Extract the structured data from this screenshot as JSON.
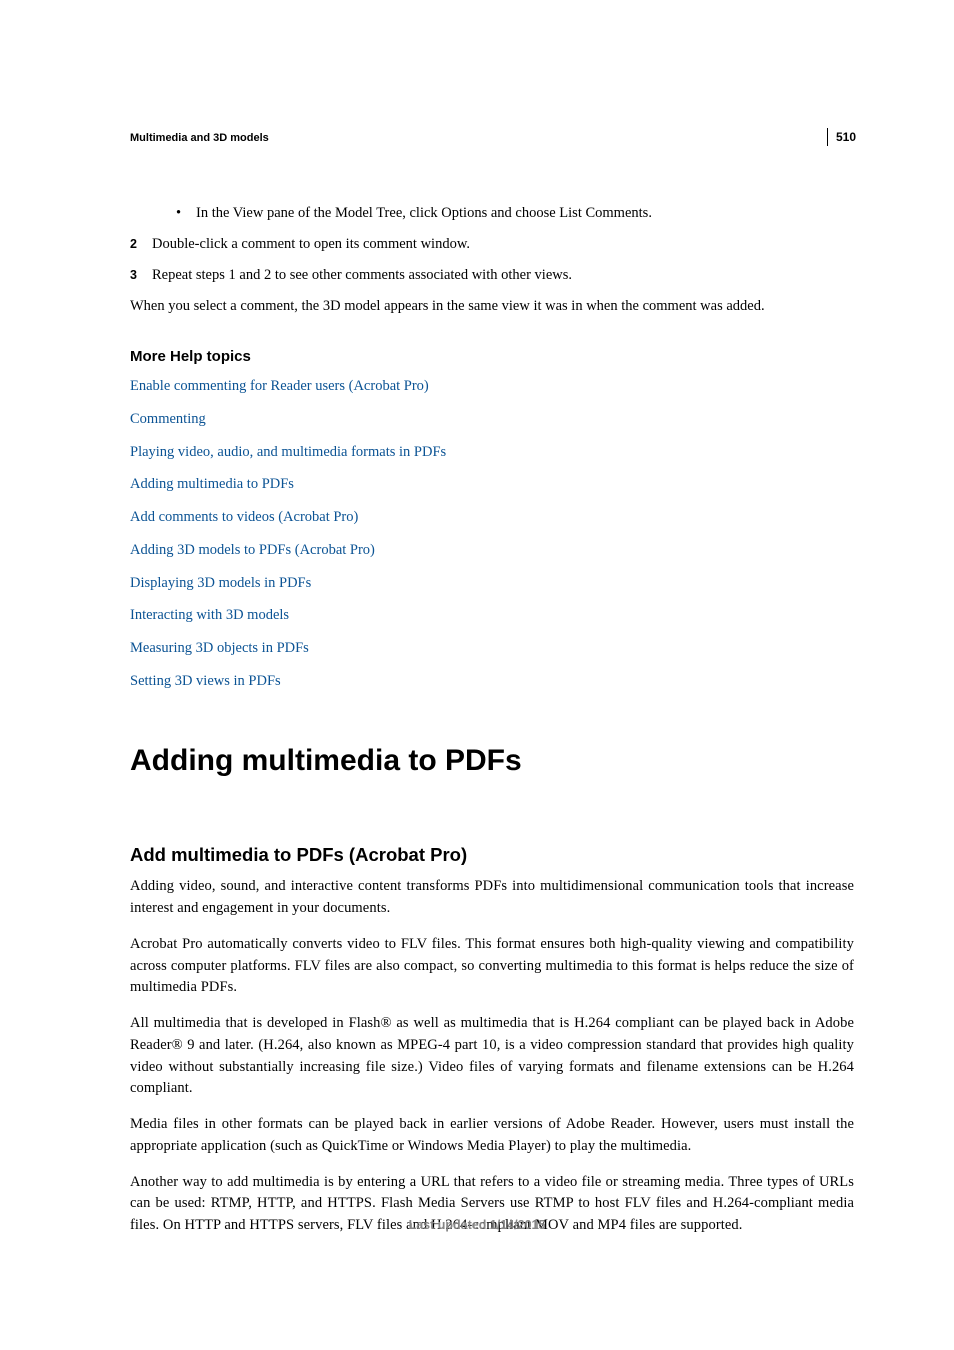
{
  "pageNumber": "510",
  "sectionHeader": "Multimedia and 3D models",
  "bulletItem": "In the View pane of the Model Tree, click Options and choose List Comments.",
  "steps": {
    "n2": "2",
    "t2": "Double-click a comment to open its comment window.",
    "n3": "3",
    "t3": "Repeat steps 1 and 2 to see other comments associated with other views."
  },
  "note": "When you select a comment, the 3D model appears in the same view it was in when the comment was added.",
  "moreHelp": {
    "heading": "More Help topics",
    "links": [
      "Enable commenting for Reader users (Acrobat Pro)",
      "Commenting",
      "Playing video, audio, and multimedia formats in PDFs",
      "Adding multimedia to PDFs",
      "Add comments to videos (Acrobat Pro)",
      "Adding 3D models to PDFs (Acrobat Pro)",
      "Displaying 3D models in PDFs",
      "Interacting with 3D models",
      "Measuring 3D objects in PDFs",
      "Setting 3D views in PDFs"
    ]
  },
  "mainHeading": "Adding multimedia to PDFs",
  "subHeading": "Add multimedia to PDFs (Acrobat Pro)",
  "paragraphs": {
    "p1": "Adding video, sound, and interactive content transforms PDFs into multidimensional communication tools that increase interest and engagement in your documents.",
    "p2": "Acrobat Pro automatically converts video to FLV files. This format ensures both high-quality viewing and compatibility across computer platforms. FLV files are also compact, so converting multimedia to this format is helps reduce the size of multimedia PDFs.",
    "p3": "All multimedia that is developed in Flash® as well as multimedia that is H.264 compliant can be played back in Adobe Reader® 9 and later. (H.264, also known as MPEG-4 part 10, is a video compression standard that provides high quality video without substantially increasing file size.) Video files of varying formats and filename extensions can be H.264 compliant.",
    "p4": "Media files in other formats can be played back in earlier versions of Adobe Reader. However, users must install the appropriate application (such as QuickTime or Windows Media Player) to play the multimedia.",
    "p5": "Another way to add multimedia is by entering a URL that refers to a video file or streaming media. Three types of URLs can be used: RTMP, HTTP, and HTTPS. Flash Media Servers use RTMP to host FLV files and H.264-compliant media files. On HTTP and HTTPS servers, FLV files and H.264-compliant MOV and MP4 files are supported."
  },
  "footer": "Last updated 1/14/2015"
}
